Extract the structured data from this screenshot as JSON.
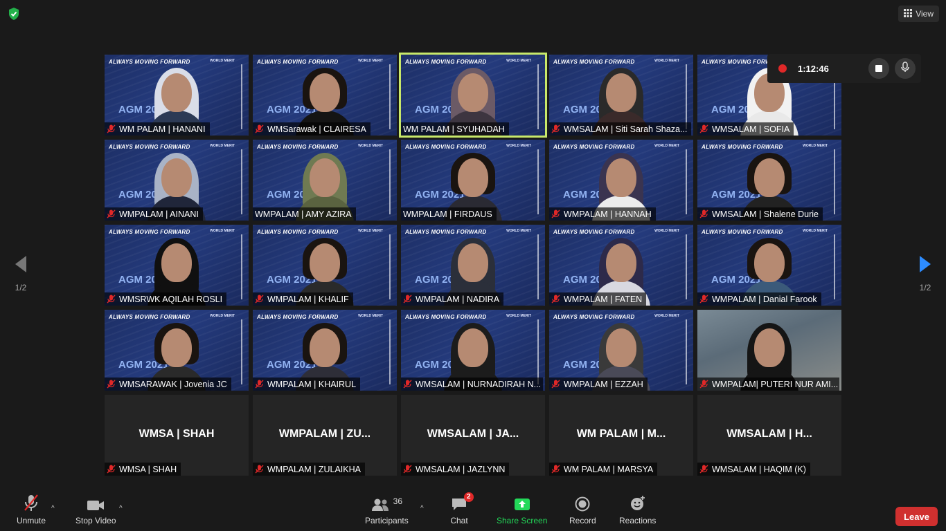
{
  "top": {
    "view_label": "View"
  },
  "recording": {
    "time": "1:12:46"
  },
  "tile_banner": "ALWAYS MOVING FORWARD",
  "tile_logo": "WORLD MERIT",
  "tile_agm": "AGM 2021",
  "tiles": [
    {
      "name": "WM PALAM | HANANI",
      "muted": true,
      "hijab": "#d9dde8",
      "body": "#2c3a55"
    },
    {
      "name": "WMSarawak | CLAIRESA",
      "muted": true,
      "hijab": "",
      "body": "#141414"
    },
    {
      "name": "WM PALAM | SYUHADAH",
      "muted": false,
      "active": true,
      "hijab": "#6b5a66",
      "body": "#3d3540"
    },
    {
      "name": "WMSALAM | Siti Sarah Shaza...",
      "muted": true,
      "hijab": "#2a2a2a",
      "body": "#3a2a2a"
    },
    {
      "name": "WMSALAM | SOFIA",
      "muted": true,
      "hijab": "#f2f2f2",
      "body": "#e9e9e9"
    },
    {
      "name": "WMPALAM | AINANI",
      "muted": true,
      "hijab": "#a9b3c6",
      "body": "#20263a"
    },
    {
      "name": "WMPALAM | AMY AZIRA",
      "muted": false,
      "hijab": "#6f7a52",
      "body": "#5a6340"
    },
    {
      "name": "WMPALAM | FIRDAUS",
      "muted": false,
      "hijab": "",
      "body": "#2a2a33"
    },
    {
      "name": "WMPALAM | HANNAH",
      "muted": true,
      "hijab": "#3a3450",
      "body": "#ececec"
    },
    {
      "name": "WMSALAM | Shalene Durie",
      "muted": true,
      "hijab": "",
      "body": "#222"
    },
    {
      "name": "WMSRWK AQILAH ROSLI",
      "muted": true,
      "hijab": "#101010",
      "body": "#101010"
    },
    {
      "name": "WMPALAM | KHALIF",
      "muted": true,
      "hijab": "",
      "body": "#2a2a2a"
    },
    {
      "name": "WMPALAM | NADIRA",
      "muted": true,
      "hijab": "#2b2f3a",
      "body": "#2b2f3a"
    },
    {
      "name": "WMPALAM | FATEN",
      "muted": true,
      "hijab": "#2d2a4a",
      "body": "#d8d8e0"
    },
    {
      "name": "WMPALAM | Danial Farook",
      "muted": true,
      "hijab": "",
      "body": "#3b5a7a"
    },
    {
      "name": "WMSARAWAK | Jovenia JC",
      "muted": true,
      "hijab": "",
      "body": "#2a2a2a"
    },
    {
      "name": "WMPALAM | KHAIRUL",
      "muted": true,
      "hijab": "",
      "body": "#2e2e38"
    },
    {
      "name": "WMSALAM | NURNADIRAH N...",
      "muted": true,
      "hijab": "#1c1c1c",
      "body": "#1c1c1c"
    },
    {
      "name": "WMPALAM | EZZAH",
      "muted": true,
      "hijab": "#3a3a3a",
      "body": "#4a4a58"
    },
    {
      "name": "WMPALAM| PUTERI NUR AMI...",
      "muted": true,
      "hijab": "#151515",
      "body": "#151515",
      "photo": true
    }
  ],
  "name_tiles": [
    {
      "big": "WMSA | SHAH",
      "name": "WMSA | SHAH"
    },
    {
      "big": "WMPALAM | ZU...",
      "name": "WMPALAM | ZULAIKHA"
    },
    {
      "big": "WMSALAM | JA...",
      "name": "WMSALAM | JAZLYNN"
    },
    {
      "big": "WM PALAM | M...",
      "name": "WM PALAM | MARSYA"
    },
    {
      "big": "WMSALAM | H...",
      "name": "WMSALAM | HAQIM (K)"
    }
  ],
  "pagination": {
    "left": "1/2",
    "right": "1/2"
  },
  "toolbar": {
    "unmute": "Unmute",
    "stop_video": "Stop Video",
    "participants": "Participants",
    "participants_count": "36",
    "chat": "Chat",
    "chat_badge": "2",
    "share_screen": "Share Screen",
    "record": "Record",
    "reactions": "Reactions",
    "leave": "Leave"
  },
  "colors": {
    "share_green": "#23d959",
    "leave_red": "#d0302f",
    "active_border": "#c8e86a"
  }
}
